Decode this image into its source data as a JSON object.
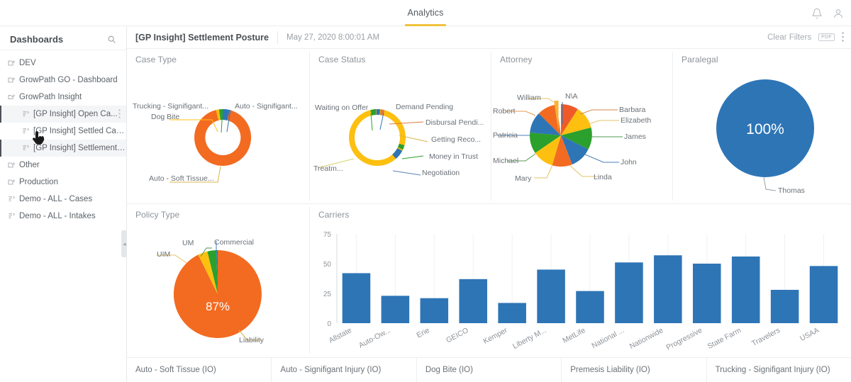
{
  "topbar": {
    "tabs": [
      {
        "label": "Analytics",
        "active": true
      }
    ],
    "icons": [
      "bell-icon",
      "account-icon"
    ]
  },
  "sidebar": {
    "title": "Dashboards",
    "search_icon": "search-icon",
    "items": [
      {
        "label": "DEV",
        "icon": "folder-share-icon",
        "level": 0,
        "selected": false
      },
      {
        "label": "GrowPath GO - Dashboard",
        "icon": "folder-share-icon",
        "level": 0,
        "selected": false
      },
      {
        "label": "GrowPath Insight",
        "icon": "folder-open-share-icon",
        "level": 0,
        "selected": false
      },
      {
        "label": "[GP Insight] Open Ca...",
        "icon": "dashboard-share-icon",
        "level": 1,
        "selected": true
      },
      {
        "label": "[GP Insight] Settled Cases",
        "icon": "dashboard-share-icon",
        "level": 1,
        "selected": false
      },
      {
        "label": "[GP Insight] Settlement P...",
        "icon": "dashboard-share-icon",
        "level": 1,
        "selected": true
      },
      {
        "label": "Other",
        "icon": "folder-share-icon",
        "level": 0,
        "selected": false
      },
      {
        "label": "Production",
        "icon": "folder-share-icon",
        "level": 0,
        "selected": false
      },
      {
        "label": "Demo - ALL - Cases",
        "icon": "dashboard-share-icon",
        "level": 0,
        "selected": false
      },
      {
        "label": "Demo - ALL - Intakes",
        "icon": "dashboard-share-icon",
        "level": 0,
        "selected": false
      }
    ]
  },
  "dashboard_header": {
    "title": "[GP Insight] Settlement Posture",
    "date": "May 27, 2020 8:00:01 AM",
    "clear_filters": "Clear Filters",
    "pdf_label": "PDF",
    "menu_icon": "kebab-menu-icon"
  },
  "panels": {
    "case_type": "Case Type",
    "case_status": "Case Status",
    "attorney": "Attorney",
    "paralegal": "Paralegal",
    "policy_type": "Policy Type",
    "carriers": "Carriers"
  },
  "bottom_tabs": [
    "Auto - Soft Tissue (IO)",
    "Auto - Signifigant Injury (IO)",
    "Dog Bite (IO)",
    "Premesis Liability (IO)",
    "Trucking - Signifigant Injury (IO)"
  ],
  "colors": {
    "orange": "#f26b21",
    "blue": "#2e75b6",
    "yellow": "#fdc010",
    "green": "#2ca02c",
    "accent_tab": "#f0c23c",
    "bar_blue": "#2e75b6",
    "text_muted": "#8d9399"
  },
  "chart_data": [
    {
      "type": "pie",
      "title": "Case Type",
      "variant": "donut",
      "labels": [
        "Auto - Soft Tissue...",
        "Auto - Signifigant...",
        "Trucking - Signifigant...",
        "Dog Bite"
      ],
      "values": [
        94,
        3,
        2,
        1
      ],
      "colors": [
        "#f26b21",
        "#2e75b6",
        "#2ca02c",
        "#fdc010"
      ],
      "legend": "leader-lines"
    },
    {
      "type": "pie",
      "title": "Case Status",
      "variant": "donut",
      "labels": [
        "Treatm...",
        "Waiting on Offer",
        "Demand Pending",
        "Disbursal Pendi...",
        "Getting Reco...",
        "Money in Trust",
        "Negotiation"
      ],
      "values": [
        83,
        3,
        2,
        2,
        2,
        3,
        5
      ],
      "colors": [
        "#fdc010",
        "#2ca02c",
        "#2e75b6",
        "#e07b39",
        "#fdc010",
        "#2ca02c",
        "#2e75b6"
      ],
      "legend": "leader-lines"
    },
    {
      "type": "pie",
      "title": "Attorney",
      "variant": "pie",
      "labels": [
        "N\\A",
        "Barbara",
        "Elizabeth",
        "James",
        "John",
        "Linda",
        "Mary",
        "Michael",
        "Patricia",
        "Robert",
        "William"
      ],
      "values": [
        9,
        9,
        9,
        9,
        9,
        9,
        9,
        9,
        9,
        9,
        9
      ],
      "colors": [
        "#f05a28",
        "#fdc010",
        "#2ca02c",
        "#2e75b6",
        "#f26b21",
        "#fdc010",
        "#2ca02c",
        "#2e75b6",
        "#f26b21",
        "#fdc010",
        "#f9b233"
      ],
      "legend": "leader-lines"
    },
    {
      "type": "pie",
      "title": "Paralegal",
      "variant": "pie",
      "labels": [
        "Thomas"
      ],
      "values": [
        100
      ],
      "data_labels": [
        "100%"
      ],
      "colors": [
        "#2e75b6"
      ],
      "legend": "leader-lines"
    },
    {
      "type": "pie",
      "title": "Policy Type",
      "variant": "pie",
      "labels": [
        "Liability",
        "UIM",
        "UM",
        "Commercial"
      ],
      "values": [
        87,
        4,
        8,
        1
      ],
      "data_labels": [
        "87%"
      ],
      "colors": [
        "#f26b21",
        "#fdc010",
        "#2ca02c",
        "#2e75b6"
      ],
      "legend": "leader-lines"
    },
    {
      "type": "bar",
      "title": "Carriers",
      "categories": [
        "Allstate",
        "Auto-Ow...",
        "Erie",
        "GEICO",
        "Kemper",
        "Liberty M...",
        "MetLife",
        "National ...",
        "Nationwide",
        "Progressive",
        "State Farm",
        "Travelers",
        "USAA"
      ],
      "values": [
        42,
        23,
        21,
        37,
        17,
        45,
        27,
        51,
        57,
        50,
        56,
        28,
        48
      ],
      "ylim": [
        0,
        75
      ],
      "yticks": [
        0,
        25,
        50,
        75
      ],
      "xlabel": "",
      "ylabel": "",
      "grid": false,
      "color": "#2e75b6"
    }
  ]
}
